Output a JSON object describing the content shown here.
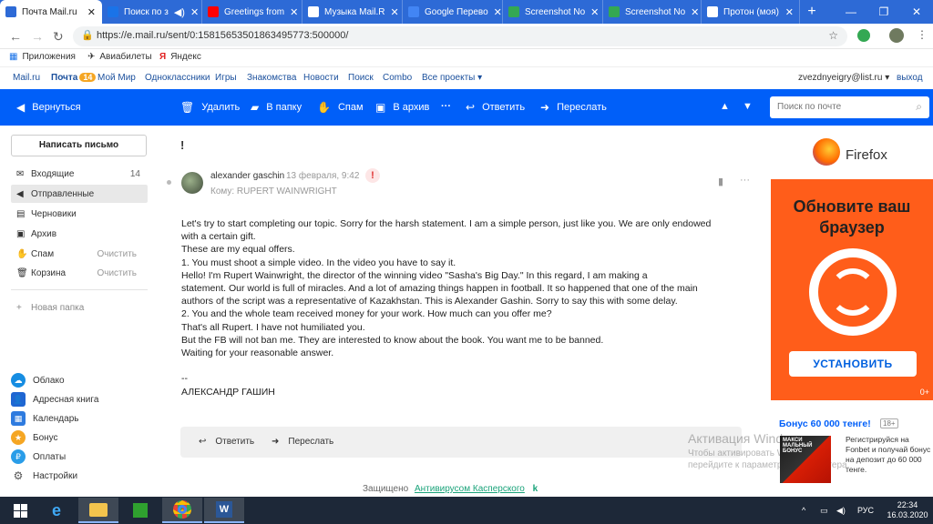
{
  "browser": {
    "tabs": [
      {
        "title": "Почта Mail.ru",
        "favicon_color": "#2d6ad6",
        "active": true
      },
      {
        "title": "Поиск по з",
        "favicon_color": "#1a73e8",
        "active": false
      },
      {
        "title": "Greetings from",
        "favicon_color": "#ff0000",
        "active": false
      },
      {
        "title": "Музыка Mail.R",
        "favicon_color": "#005ff9",
        "active": false
      },
      {
        "title": "Google Перево",
        "favicon_color": "#4285f4",
        "active": false
      },
      {
        "title": "Screenshot No",
        "favicon_color": "#34a853",
        "active": false
      },
      {
        "title": "Screenshot No",
        "favicon_color": "#34a853",
        "active": false
      },
      {
        "title": "Протон (моя)",
        "favicon_color": "#1a73e8",
        "active": false
      }
    ],
    "url": "https://e.mail.ru/sent/0:15815653501863495773:500000/",
    "bookmarks": [
      "Приложения",
      "Авиабилеты",
      "Яндекс"
    ]
  },
  "portal_nav": {
    "items": [
      "Mail.ru",
      "Почта",
      "Мой Мир",
      "Одноклассники",
      "Игры",
      "Знакомства",
      "Новости",
      "Поиск",
      "Combo",
      "Все проекты"
    ],
    "mail_badge": "14",
    "user_email": "zvezdnyeigry@list.ru",
    "logout": "выход"
  },
  "toolbar": {
    "back": "Вернуться",
    "delete": "Удалить",
    "to_folder": "В папку",
    "spam": "Спам",
    "archive": "В архив",
    "more": "···",
    "reply": "Ответить",
    "forward": "Переслать",
    "search_placeholder": "Поиск по почте"
  },
  "sidebar": {
    "compose": "Написать письмо",
    "folders": [
      {
        "icon": "inbox-icon",
        "label": "Входящие",
        "count": "14",
        "action": ""
      },
      {
        "icon": "sent-icon",
        "label": "Отправленные",
        "count": "",
        "action": ""
      },
      {
        "icon": "drafts-icon",
        "label": "Черновики",
        "count": "",
        "action": ""
      },
      {
        "icon": "archive-icon",
        "label": "Архив",
        "count": "",
        "action": ""
      },
      {
        "icon": "spam-icon",
        "label": "Спам",
        "count": "",
        "action": "Очистить"
      },
      {
        "icon": "trash-icon",
        "label": "Корзина",
        "count": "",
        "action": "Очистить"
      }
    ],
    "new_folder": "Новая папка",
    "services": [
      {
        "icon": "cloud-icon",
        "label": "Облако",
        "color": "#168de2"
      },
      {
        "icon": "address-book-icon",
        "label": "Адресная книга",
        "color": "#1f66d2"
      },
      {
        "icon": "calendar-icon",
        "label": "Календарь",
        "color": "#2e7bdf"
      },
      {
        "icon": "bonus-icon",
        "label": "Бонус",
        "color": "#f5a623"
      },
      {
        "icon": "payments-icon",
        "label": "Оплаты",
        "color": "#2a9de8"
      },
      {
        "icon": "settings-icon",
        "label": "Настройки",
        "color": "#555555"
      }
    ]
  },
  "message": {
    "subject": "!",
    "sender": "alexander gaschin",
    "date": "13 февраля, 9:42",
    "recipient": "Кому: RUPERT WAINWRIGHT",
    "body_lines": [
      "Let's try to start completing our topic. Sorry for the harsh statement. I am a simple person, just like you. We are only endowed",
      "with a certain gift.",
      "These are my equal offers.",
      "1. You must shoot a simple video. In the video you have to say it.",
      "Hello! I'm Rupert Wainwright, the director of the winning video \"Sasha's Big Day.\" In this regard, I am making a",
      "statement. Our world is full of miracles. And a lot of amazing things happen in football. It so happened that one of the main",
      "authors of the script was a representative of Kazakhstan. This is Alexander Gashin. Sorry to say this with some delay.",
      "2. You and the whole team received money for your work. How much can you offer me?",
      "That's all Rupert. I have not humiliated you.",
      "But the FB will not ban me. They are interested to know about the book. You want me to be banned.",
      "Waiting for your reasonable answer.",
      "",
      "--",
      "АЛЕКСАНДР ГАШИН"
    ],
    "reply": "Ответить",
    "forward": "Переслать"
  },
  "footer": {
    "protected": "Защищено",
    "antivirus": "Антивирусом Касперского",
    "k_logo": "k"
  },
  "windows_activation": {
    "title": "Активация Windows",
    "subtitle": "Чтобы активировать Windows, перейдите к параметрам компьютера."
  },
  "ad_firefox": {
    "brand": "Firefox",
    "headline": "Обновите ваш браузер",
    "button": "УСТАНОВИТЬ",
    "age": "0+"
  },
  "ad_bonus": {
    "title": "Бонус 60 000 тенге!",
    "age": "18+",
    "image_text": "МАКСИ МАЛЬНЫЙ БОНУС",
    "text": "Регистрируйся на Fonbet и получай бонус на депозит до 60 000 тенге."
  },
  "taskbar": {
    "lang": "РУС",
    "time": "22:34",
    "date": "16.03.2020"
  }
}
